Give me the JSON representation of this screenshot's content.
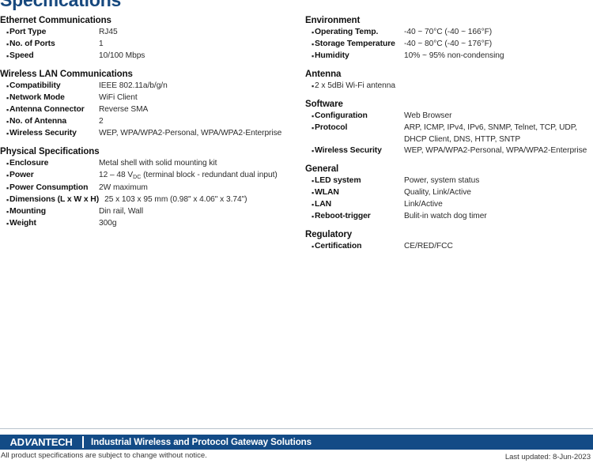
{
  "page_title": "Specifications",
  "title_color": "#16487e",
  "accent_color": "#134b86",
  "left_column": [
    {
      "heading": "Ethernet Communications",
      "rows": [
        {
          "label": "Port Type",
          "value": "RJ45"
        },
        {
          "label": "No. of Ports",
          "value": "1"
        },
        {
          "label": "Speed",
          "value": "10/100 Mbps"
        }
      ]
    },
    {
      "heading": "Wireless LAN Communications",
      "rows": [
        {
          "label": "Compatibility",
          "value": "IEEE 802.11a/b/g/n"
        },
        {
          "label": "Network Mode",
          "value": "WiFi Client"
        },
        {
          "label": "Antenna Connector",
          "value": "Reverse SMA"
        },
        {
          "label": "No. of Antenna",
          "value": "2"
        },
        {
          "label": "Wireless Security",
          "value": "WEP, WPA/WPA2-Personal, WPA/WPA2-Enterprise"
        }
      ]
    },
    {
      "heading": "Physical Specifications",
      "rows": [
        {
          "label": "Enclosure",
          "value": "Metal shell with solid mounting kit"
        },
        {
          "label": "Power",
          "value_prefix": "12 – 48 V",
          "value_sub": "DC",
          "value_suffix": " (terminal block - redundant dual input)"
        },
        {
          "label": "Power Consumption",
          "value": "2W maximum"
        },
        {
          "label": "Dimensions (L x W x H)",
          "value": "25 x 103 x 95 mm (0.98\" x 4.06\" x 3.74\")",
          "wide_label": true
        },
        {
          "label": "Mounting",
          "value": "Din rail, Wall"
        },
        {
          "label": "Weight",
          "value": "300g"
        }
      ]
    }
  ],
  "right_column": [
    {
      "heading": "Environment",
      "rows": [
        {
          "label": "Operating Temp.",
          "value": "-40 ~ 70°C (-40 ~ 166°F)"
        },
        {
          "label": "Storage Temperature",
          "value": "-40 ~ 80°C (-40 ~ 176°F)"
        },
        {
          "label": "Humidity",
          "value": "10% ~ 95% non-condensing"
        }
      ]
    },
    {
      "heading": "Antenna",
      "rows": [
        {
          "plain": true,
          "value": "2 x 5dBi Wi-Fi antenna"
        }
      ]
    },
    {
      "heading": "Software",
      "rows": [
        {
          "label": "Configuration",
          "value": "Web Browser"
        },
        {
          "label": "Protocol",
          "value": "ARP, ICMP, IPv4, IPv6, SNMP, Telnet, TCP, UDP, DHCP Client, DNS, HTTP, SNTP"
        },
        {
          "label": "Wireless Security",
          "value": "WEP, WPA/WPA2-Personal, WPA/WPA2-Enterprise"
        }
      ]
    },
    {
      "heading": "General",
      "rows": [
        {
          "label": "LED system",
          "value": "Power, system status"
        },
        {
          "label": "WLAN",
          "value": "Quality, Link/Active"
        },
        {
          "label": "LAN",
          "value": "Link/Active"
        },
        {
          "label": "Reboot-trigger",
          "value": "Bulit-in watch dog timer"
        }
      ]
    },
    {
      "heading": "Regulatory",
      "rows": [
        {
          "label": "Certification",
          "value": "CE/RED/FCC"
        }
      ]
    }
  ],
  "footer": {
    "logo_part1": "AD",
    "logo_part2": "V",
    "logo_part3": "ANTECH",
    "tagline": "Industrial Wireless and Protocol Gateway Solutions",
    "note": "All product specifications are subject to change without notice.",
    "last_updated": "Last updated: 8-Jun-2023"
  }
}
